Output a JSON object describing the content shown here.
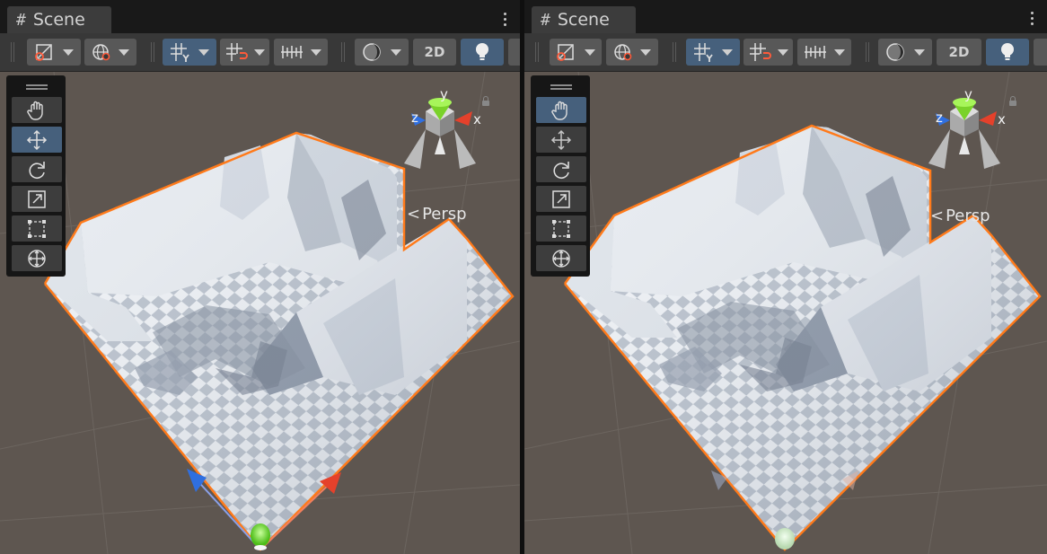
{
  "panels": [
    {
      "tab_title": "Scene",
      "toolbar": {
        "btn_2d": "2D",
        "icons": [
          "draw-mode-icon",
          "globe-icon",
          "grid-snap-icon",
          "increment-snap-icon",
          "ruler-icon",
          "shading-icon",
          "light-icon"
        ]
      },
      "tools": [
        "hand-tool",
        "move-tool",
        "rotate-tool",
        "scale-tool",
        "rect-tool",
        "transform-tool"
      ],
      "active_tool": "move-tool",
      "persp_label": "Persp",
      "axis": {
        "x": "x",
        "y": "y",
        "z": "z"
      }
    },
    {
      "tab_title": "Scene",
      "toolbar": {
        "btn_2d": "2D",
        "icons": [
          "draw-mode-icon",
          "globe-icon",
          "grid-snap-icon",
          "increment-snap-icon",
          "ruler-icon",
          "shading-icon",
          "light-icon"
        ]
      },
      "tools": [
        "hand-tool",
        "move-tool",
        "rotate-tool",
        "scale-tool",
        "rect-tool",
        "transform-tool"
      ],
      "active_tool": "hand-tool",
      "persp_label": "Persp",
      "axis": {
        "x": "x",
        "y": "y",
        "z": "z"
      }
    }
  ],
  "colors": {
    "selection_outline": "#ff7a1a",
    "active_blue": "#46607c",
    "x_axis": "#e5412b",
    "y_axis": "#7ad22a",
    "z_axis": "#2f6fe0"
  }
}
